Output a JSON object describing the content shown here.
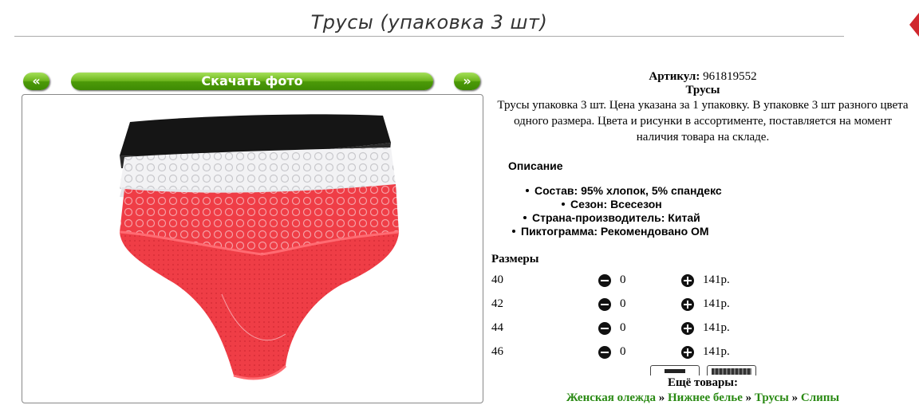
{
  "page": {
    "title": "Трусы (упаковка 3 шт)"
  },
  "gallery": {
    "prev_label": "«",
    "next_label": "»",
    "download_label": "Скачать фото"
  },
  "product": {
    "article_label": "Артикул:",
    "article": "961819552",
    "name": "Трусы",
    "description": "Трусы упаковка 3 шт. Цена указана за 1 упаковку. В упаковке 3 шт разного цвета одного размера. Цвета и рисунки в ассортименте, поставляется на момент наличия товара на складе."
  },
  "specs": {
    "heading": "Описание",
    "items": [
      "Состав: 95% хлопок, 5% спандекс",
      "Сезон: Всесезон",
      "Страна-производитель: Китай",
      "Пиктограмма: Рекомендовано ОМ"
    ]
  },
  "sizes": {
    "heading": "Размеры",
    "rows": [
      {
        "size": "40",
        "qty": "0",
        "price": "141р."
      },
      {
        "size": "42",
        "qty": "0",
        "price": "141р."
      },
      {
        "size": "44",
        "qty": "0",
        "price": "141р."
      },
      {
        "size": "46",
        "qty": "0",
        "price": "141р."
      }
    ]
  },
  "more": {
    "label": "Ещё товары:",
    "crumbs": [
      "Женская олежда",
      "Нижнее белье",
      "Трусы",
      "Слипы"
    ],
    "separator": "»"
  },
  "colors": {
    "accent_green": "#5aa80e",
    "link_green": "#2a8a14",
    "product_red": "#ef3d46"
  }
}
